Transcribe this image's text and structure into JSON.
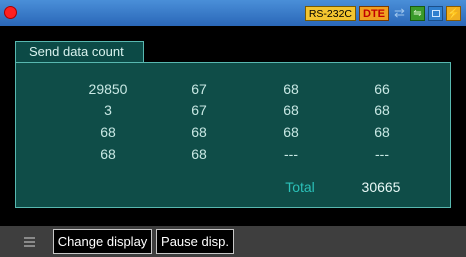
{
  "status": {
    "interface": "RS-232C",
    "mode": "DTE"
  },
  "tab": {
    "label": "Send data count"
  },
  "table": {
    "rows": [
      [
        "29850",
        "67",
        "68",
        "66"
      ],
      [
        "3",
        "67",
        "68",
        "68"
      ],
      [
        "68",
        "68",
        "68",
        "68"
      ],
      [
        "68",
        "68",
        "---",
        "---"
      ]
    ],
    "total_label": "Total",
    "total_value": "30665"
  },
  "footer": {
    "change_display": "Change display",
    "pause_display": "Pause disp."
  },
  "icons": [
    "record-indicator-icon",
    "signal-icon",
    "network-icon",
    "card-icon",
    "power-icon",
    "menu-icon"
  ],
  "colors": {
    "topbar": "#2a67b8",
    "panel": "#0f4d48",
    "panel_border": "#58b8b0",
    "total_label": "#2bc0b8",
    "record": "#ff2020"
  }
}
